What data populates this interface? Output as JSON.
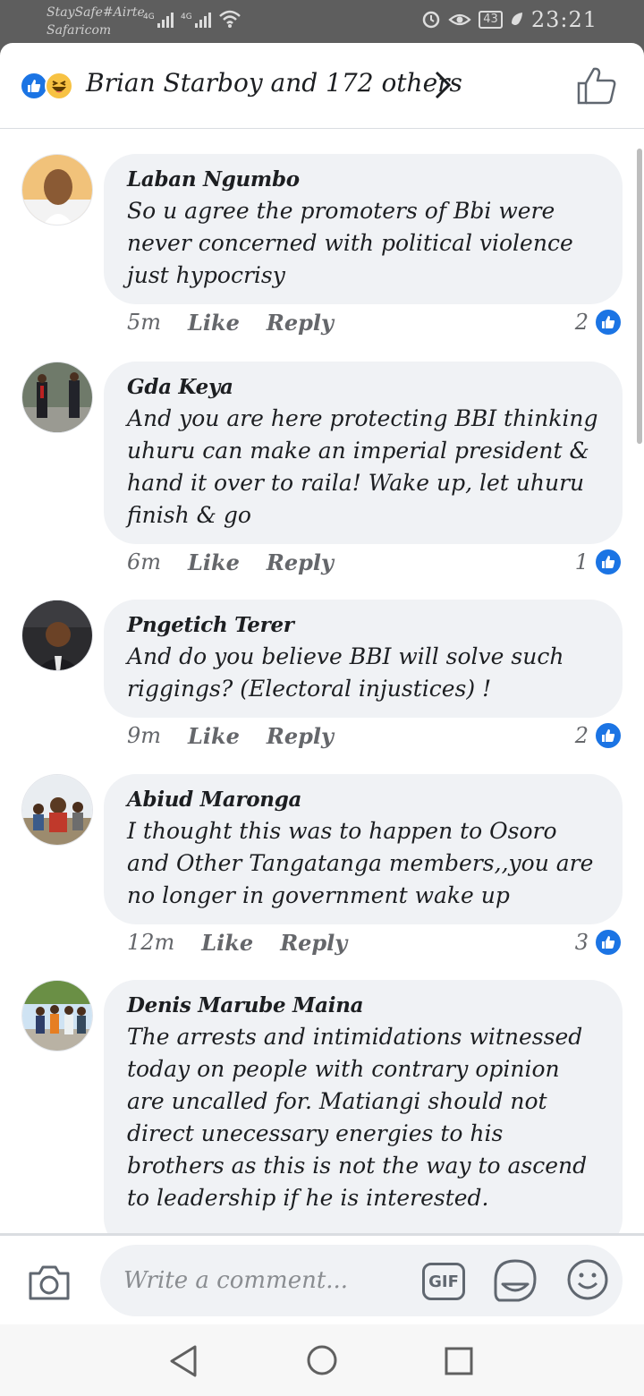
{
  "status_bar": {
    "carrier_1": "StaySafe#Airte",
    "carrier_2": "Safaricom",
    "network_1": "4G",
    "network_2": "4G",
    "battery": "43",
    "time": "23:21"
  },
  "reactions": {
    "summary": "Brian Starboy and 172 others",
    "icons": [
      "like-icon",
      "haha-icon"
    ]
  },
  "comments": [
    {
      "author": "Laban Ngumbo",
      "text": "So u agree the promoters of Bbi were never concerned with political violence just hypocrisy",
      "time": "5m",
      "like_label": "Like",
      "reply_label": "Reply",
      "likes": "2"
    },
    {
      "author": "Gda Keya",
      "text": "And you are here protecting BBI thinking uhuru can make an imperial president & hand it over to raila! Wake up, let uhuru finish & go",
      "time": "6m",
      "like_label": "Like",
      "reply_label": "Reply",
      "likes": "1"
    },
    {
      "author": "Pngetich Terer",
      "text": "And do you believe BBI will solve such riggings? (Electoral injustices) !",
      "time": "9m",
      "like_label": "Like",
      "reply_label": "Reply",
      "likes": "2"
    },
    {
      "author": "Abiud Maronga",
      "text": "I thought this was to happen to Osoro and Other Tangatanga members,,you are no longer in government wake up",
      "time": "12m",
      "like_label": "Like",
      "reply_label": "Reply",
      "likes": "3"
    },
    {
      "author": "Denis Marube Maina",
      "text": "The arrests and intimidations witnessed today on people with contrary opinion are uncalled for. Matiangi should not direct unecessary energies to his brothers as this is not the way to ascend to leadership if he is interested."
    }
  ],
  "composer": {
    "placeholder": "Write a comment...",
    "gif_label": "GIF"
  },
  "colors": {
    "accent": "#1b74e4",
    "bubble": "#f0f2f5",
    "meta_text": "#65676b"
  }
}
